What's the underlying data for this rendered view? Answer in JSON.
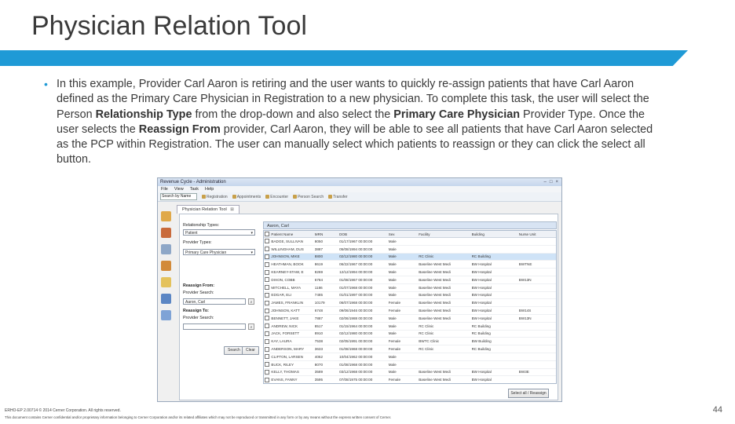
{
  "slide": {
    "title": "Physician Relation Tool",
    "bullet": "•",
    "text_parts": [
      {
        "text": "In this example, Provider Carl Aaron is retiring and the user wants to quickly re-assign patients that have Carl Aaron defined as the Primary Care Physician in Registration to a new physician. To complete this task, the user will select the Person ",
        "bold": false
      },
      {
        "text": "Relationship Type",
        "bold": true
      },
      {
        "text": " from the drop-down and also select the ",
        "bold": false
      },
      {
        "text": "Primary Care Physician",
        "bold": true
      },
      {
        "text": " Provider Type. Once the user selects the ",
        "bold": false
      },
      {
        "text": "Reassign From",
        "bold": true
      },
      {
        "text": " provider, Carl Aaron, they will be able to see all patients that have Carl Aaron selected as the PCP within Registration. The user can manually select which patients to reassign or they can click the select all button.",
        "bold": false
      }
    ],
    "footer_line1": "ERHO-EP 2.00714 © 2014 Cerner Corporation. All rights reserved.",
    "footer_line2": "This document contains Cerner confidential and/or proprietary information belonging to Cerner Corporation and/or its related affiliates which may not be reproduced or transmitted in any form or by any means without the express written consent of Cerner.",
    "page_number": "44",
    "accent_color": "#1f9ad6"
  },
  "app": {
    "window_title": "Revenue Cycle - Administration",
    "window_controls": [
      "–",
      "□",
      "×"
    ],
    "menu": [
      "File",
      "View",
      "Task",
      "Help"
    ],
    "search_select": "Search by Name",
    "toolbar_buttons": [
      "Registration",
      "Appointments",
      "Encounter",
      "Person Search",
      "Transfer"
    ],
    "tab_label": "Physician Relation Tool",
    "tab_close": "⊠",
    "left_panel": {
      "relationship_types_label": "Relationship Types:",
      "relationship_type_value": "Patient",
      "provider_types_label": "Provider Types:",
      "provider_type_value": "Primary Care Physician",
      "reassign_from_label": "Reassign From:",
      "provider_search_label": "Provider Search:",
      "reassign_from_value": "Aaron, Carl",
      "reassign_to_label": "Reassign To:",
      "provider_search_label2": "Provider Search:",
      "search_button": "Search",
      "clear_button": "Clear"
    },
    "grid": {
      "header_label": "Aaron, Carl",
      "columns": [
        "",
        "Patient Name",
        "MRN",
        "DOB",
        "Sex",
        "Facility",
        "Building",
        "Nurse Unit"
      ],
      "rows": [
        [
          "",
          "BADGE, SULLIVAN",
          "8050",
          "01/17/1967 00:00:00",
          "Male",
          "",
          "",
          ""
        ],
        [
          "",
          "WILLINGHAM, DUS",
          "3887",
          "05/08/1994 00:00:00",
          "Male",
          "",
          "",
          ""
        ],
        [
          "",
          "JOHNSON, MIKE",
          "8800",
          "02/12/1980 00:00:00",
          "Male",
          "RC Clinic",
          "RC Building",
          ""
        ],
        [
          "",
          "HEATHMAN, BOOK",
          "8619",
          "06/22/1967 00:00:00",
          "Male",
          "Baseline West Medi",
          "BW Hospital",
          "BWTNE"
        ],
        [
          "",
          "KEARNEY-STAW, E",
          "8269",
          "12/12/1994 00:00:00",
          "Male",
          "Baseline West Medi",
          "BW Hospital",
          ""
        ],
        [
          "",
          "DIXON, COBB",
          "6784",
          "01/08/1967 00:00:00",
          "Male",
          "Baseline West Medi",
          "BW Hospital",
          "BW13N"
        ],
        [
          "",
          "MITCHELL, MAYA",
          "1186",
          "01/07/1968 00:00:00",
          "Male",
          "Baseline West Medi",
          "BW Hospital",
          ""
        ],
        [
          "",
          "EDGAR, ELI",
          "7485",
          "01/01/1997 00:00:00",
          "Male",
          "Baseline West Medi",
          "BW Hospital",
          ""
        ],
        [
          "",
          "JAMES, FRANKLIN",
          "10179",
          "06/07/1968 00:00:00",
          "Female",
          "Baseline West Medi",
          "BW Hospital",
          ""
        ],
        [
          "",
          "JOHNSON, KATT",
          "6748",
          "09/06/1946 00:00:00",
          "Female",
          "Baseline West Medi",
          "BW Hospital",
          "BW14S"
        ],
        [
          "",
          "BENNETT, JAKE",
          "7887",
          "02/06/1988 00:00:00",
          "Male",
          "Baseline West Medi",
          "BW Hospital",
          "BW13N"
        ],
        [
          "",
          "ANDREW, NICK",
          "8517",
          "01/15/1964 00:00:00",
          "Male",
          "RC Clinic",
          "RC Building",
          ""
        ],
        [
          "",
          "JACK, FORSETT",
          "8910",
          "02/12/1980 00:00:00",
          "Male",
          "RC Clinic",
          "RC Building",
          ""
        ],
        [
          "",
          "KAY, LAURA",
          "7538",
          "02/05/1991 00:00:00",
          "Female",
          "BWTC Clinic",
          "BW Building",
          ""
        ],
        [
          "",
          "ANDERSON, MARY",
          "3633",
          "01/08/1968 00:00:00",
          "Female",
          "RC Clinic",
          "RC Building",
          ""
        ],
        [
          "",
          "CLIFTON, LARSEN",
          "4062",
          "10/04/1962 00:00:00",
          "Male",
          "",
          "",
          ""
        ],
        [
          "",
          "BUCK, RILEY",
          "8070",
          "01/08/1968 00:00:00",
          "Male",
          "",
          "",
          ""
        ],
        [
          "",
          "KELLY, THOMAS",
          "3589",
          "03/12/1968 00:00:00",
          "Male",
          "Baseline West Medi",
          "BW Hospital",
          "BW3E"
        ],
        [
          "",
          "EVANS, FANNY",
          "3595",
          "07/08/1975 00:00:00",
          "Female",
          "Baseline West Medi",
          "BW Hospital",
          ""
        ],
        [
          "",
          "WATSON, WANDA",
          "1169",
          "01/08/1998 00:00:00",
          "Female",
          "RC Clinic",
          "NBC",
          ""
        ],
        [
          "",
          "SIMPSON, WYATT",
          "1186",
          "01/08/1975 00:00:00",
          "Male",
          "Baseline West Medi",
          "BW Hospital",
          ""
        ]
      ],
      "selected_row_index": 2,
      "reassign_button": "Select all / Reassign"
    }
  }
}
